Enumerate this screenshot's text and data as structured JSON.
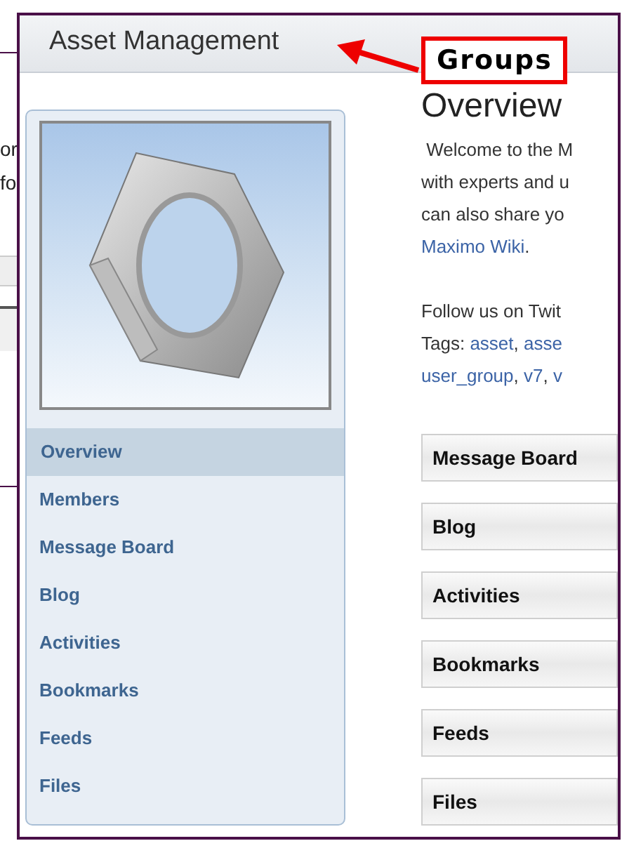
{
  "background_window": {
    "text_lines": [
      "or",
      "fo"
    ]
  },
  "window": {
    "title": "Asset Management"
  },
  "annotation": {
    "label": "Groups"
  },
  "sidebar": {
    "items": [
      {
        "label": "Overview",
        "selected": true
      },
      {
        "label": "Members",
        "selected": false
      },
      {
        "label": "Message Board",
        "selected": false
      },
      {
        "label": "Blog",
        "selected": false
      },
      {
        "label": "Activities",
        "selected": false
      },
      {
        "label": "Bookmarks",
        "selected": false
      },
      {
        "label": "Feeds",
        "selected": false
      },
      {
        "label": "Files",
        "selected": false
      }
    ]
  },
  "content": {
    "heading": "Overview",
    "paragraphs": [
      [
        [
          {
            "kind": "plain",
            "text": " Welcome to the M"
          }
        ],
        [
          {
            "kind": "plain",
            "text": "with experts and u"
          }
        ],
        [
          {
            "kind": "plain",
            "text": "can also share yo"
          }
        ],
        [
          {
            "kind": "link",
            "text": "Maximo Wiki"
          },
          {
            "kind": "plain",
            "text": "."
          }
        ]
      ],
      [
        [
          {
            "kind": "plain",
            "text": "Follow us on Twit"
          }
        ],
        [
          {
            "kind": "plain",
            "text": "Tags: "
          },
          {
            "kind": "link",
            "text": "asset"
          },
          {
            "kind": "plain",
            "text": ", "
          },
          {
            "kind": "link",
            "text": "asse"
          }
        ],
        [
          {
            "kind": "link",
            "text": "user_group"
          },
          {
            "kind": "plain",
            "text": ", "
          },
          {
            "kind": "link",
            "text": "v7"
          },
          {
            "kind": "plain",
            "text": ", "
          },
          {
            "kind": "link",
            "text": "v"
          }
        ]
      ]
    ],
    "portlets": [
      "Message Board",
      "Blog",
      "Activities",
      "Bookmarks",
      "Feeds",
      "Files"
    ]
  }
}
